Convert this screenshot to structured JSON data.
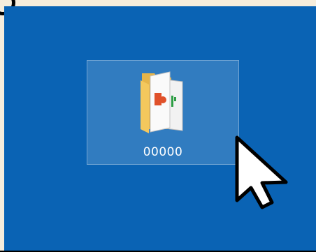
{
  "desktop": {
    "background_color": "#0a63b4",
    "items": [
      {
        "label": "00000",
        "icon": "folder-with-documents-icon",
        "selected": true
      }
    ]
  },
  "cursor": {
    "icon": "arrow-pointer-icon"
  }
}
